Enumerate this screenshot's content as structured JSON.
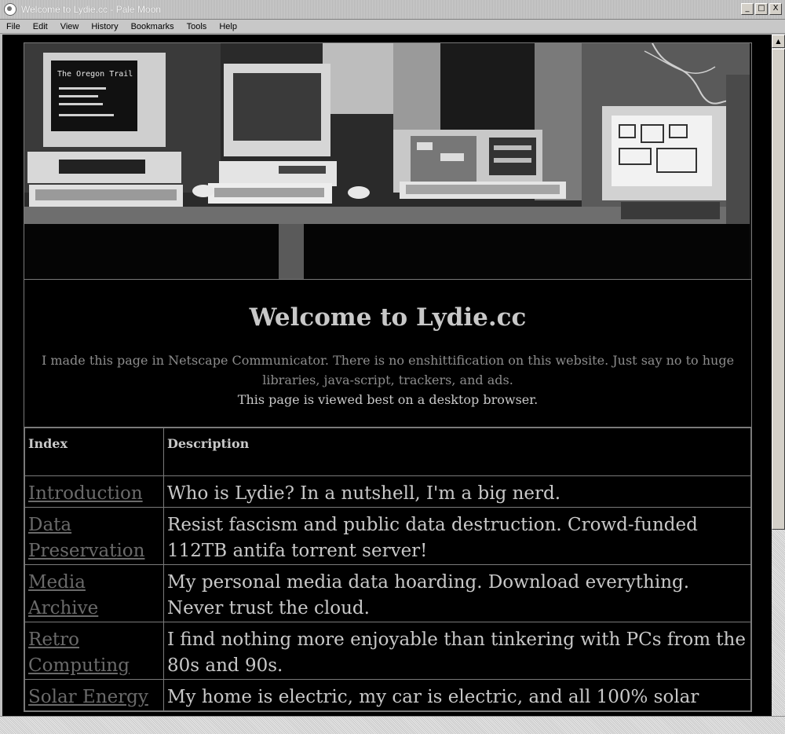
{
  "window": {
    "title": "Welcome to Lydie.cc - Pale Moon",
    "minimize": "_",
    "maximize": "□",
    "close": "X"
  },
  "menu": [
    "File",
    "Edit",
    "View",
    "History",
    "Bookmarks",
    "Tools",
    "Help"
  ],
  "hero": {
    "screen_text": "The Oregon Trail"
  },
  "intro": {
    "heading": "Welcome to Lydie.cc",
    "paragraph": "I made this page in Netscape Communicator. There is no enshittification on this website. Just say no to huge libraries, java-script, trackers, and ads.",
    "note": "This page is viewed best on a desktop browser."
  },
  "table": {
    "headers": [
      "Index",
      "Description"
    ],
    "rows": [
      {
        "link": "Introduction",
        "desc": "Who is Lydie?  In a nutshell, I'm a big nerd."
      },
      {
        "link": "Data Preservation",
        "desc": "Resist fascism and public data destruction. Crowd-funded 112TB antifa torrent server!"
      },
      {
        "link": "Media Archive",
        "desc": "My personal media data hoarding.  Download everything.  Never trust the cloud."
      },
      {
        "link": "Retro Computing",
        "desc": "I find nothing more enjoyable than tinkering with PCs from the 80s and 90s."
      },
      {
        "link": "Solar Energy",
        "desc": "My home is electric, my car is electric, and all 100% solar"
      }
    ]
  },
  "colors": {
    "background": "#000000",
    "text": "#c8c8c8",
    "link": "#6a6a6a",
    "muted": "#8c8c8c"
  }
}
